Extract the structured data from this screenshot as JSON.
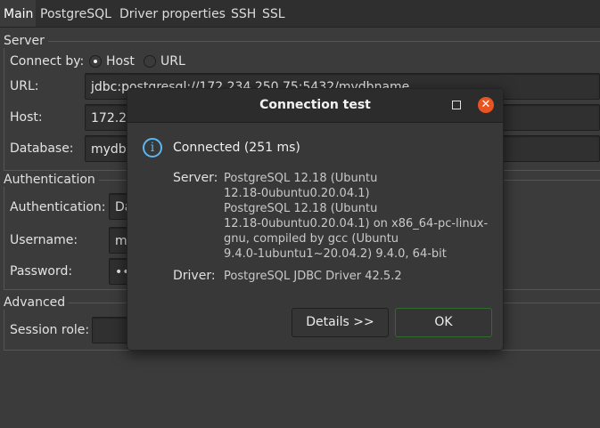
{
  "tabs": [
    "Main",
    "PostgreSQL",
    "Driver properties",
    "SSH",
    "SSL"
  ],
  "server": {
    "section_label": "Server",
    "connect_by_label": "Connect by:",
    "host_option": "Host",
    "url_option": "URL",
    "url_label": "URL:",
    "url_value": "jdbc:postgresql://172.234.250.75:5432/mydbname",
    "host_label": "Host:",
    "host_value": "172.2",
    "database_label": "Database:",
    "database_value": "mydb"
  },
  "authentication": {
    "section_label": "Authentication",
    "auth_label": "Authentication:",
    "auth_value": "Da",
    "username_label": "Username:",
    "username_value": "m",
    "password_label": "Password:",
    "password_value": "••"
  },
  "advanced": {
    "section_label": "Advanced",
    "session_role_label": "Session role:",
    "session_role_value": ""
  },
  "dialog": {
    "title": "Connection test",
    "status": "Connected (251 ms)",
    "server_label": "Server:",
    "server_value": "PostgreSQL 12.18 (Ubuntu\n12.18-0ubuntu0.20.04.1)\nPostgreSQL 12.18 (Ubuntu\n12.18-0ubuntu0.20.04.1) on x86_64-pc-linux-\ngnu, compiled by gcc (Ubuntu\n9.4.0-1ubuntu1~20.04.2) 9.4.0, 64-bit",
    "driver_label": "Driver:",
    "driver_value": "PostgreSQL JDBC Driver 42.5.2",
    "details_button": "Details >>",
    "ok_button": "OK",
    "close_glyph": "✕",
    "info_glyph": "i"
  },
  "colors": {
    "close_button": "#e95420",
    "info_icon": "#5bb7f2",
    "ok_border": "#2f6a2f"
  }
}
